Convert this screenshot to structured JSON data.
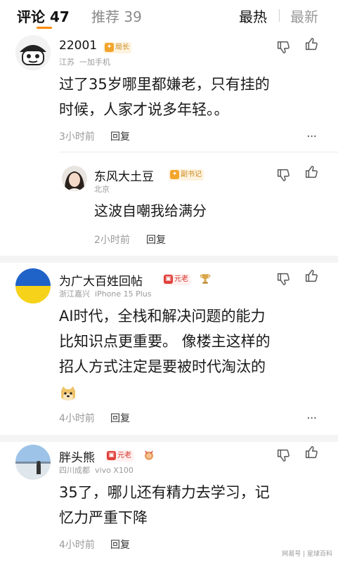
{
  "tabs": {
    "comments": "评论 47",
    "recommend": "推荐 39",
    "sort_hot": "最热",
    "sort_new": "最新"
  },
  "comments": [
    {
      "username": "22001",
      "badge": "局长",
      "location": "江苏",
      "device": "一加手机",
      "text_lines": [
        "过了35岁哪里都嫌老，只有挂的",
        "时候，人家才说多年轻。。"
      ],
      "time": "3小时前",
      "reply_label": "回复",
      "replies": [
        {
          "username": "东风大土豆",
          "badge": "副书记",
          "location": "北京",
          "text_lines": [
            "这波自嘲我给满分"
          ],
          "time": "2小时前",
          "reply_label": "回复"
        }
      ]
    },
    {
      "username": "为广大百姓回帖",
      "badge": "元老",
      "location": "浙江嘉兴",
      "device": "iPhone 15 Plus",
      "text_lines": [
        "AI时代，全栈和解决问题的能力",
        "比知识点更重要。 像楼主这样的",
        "招人方式注定是要被时代淘汰的"
      ],
      "time": "4小时前",
      "reply_label": "回复"
    },
    {
      "username": "胖头熊",
      "badge": "元老",
      "location": "四川成都",
      "device": "vivo X100",
      "text_lines": [
        "35了，哪儿还有精力去学习，记",
        "忆力严重下降"
      ],
      "time": "4小时前",
      "reply_label": "回复"
    }
  ],
  "more_label": "···",
  "watermark": "网易号 | 星球百科",
  "colors": {
    "accent": "#ff8a00",
    "badge_gold": "#f3a42a",
    "badge_red": "#e0403a"
  }
}
